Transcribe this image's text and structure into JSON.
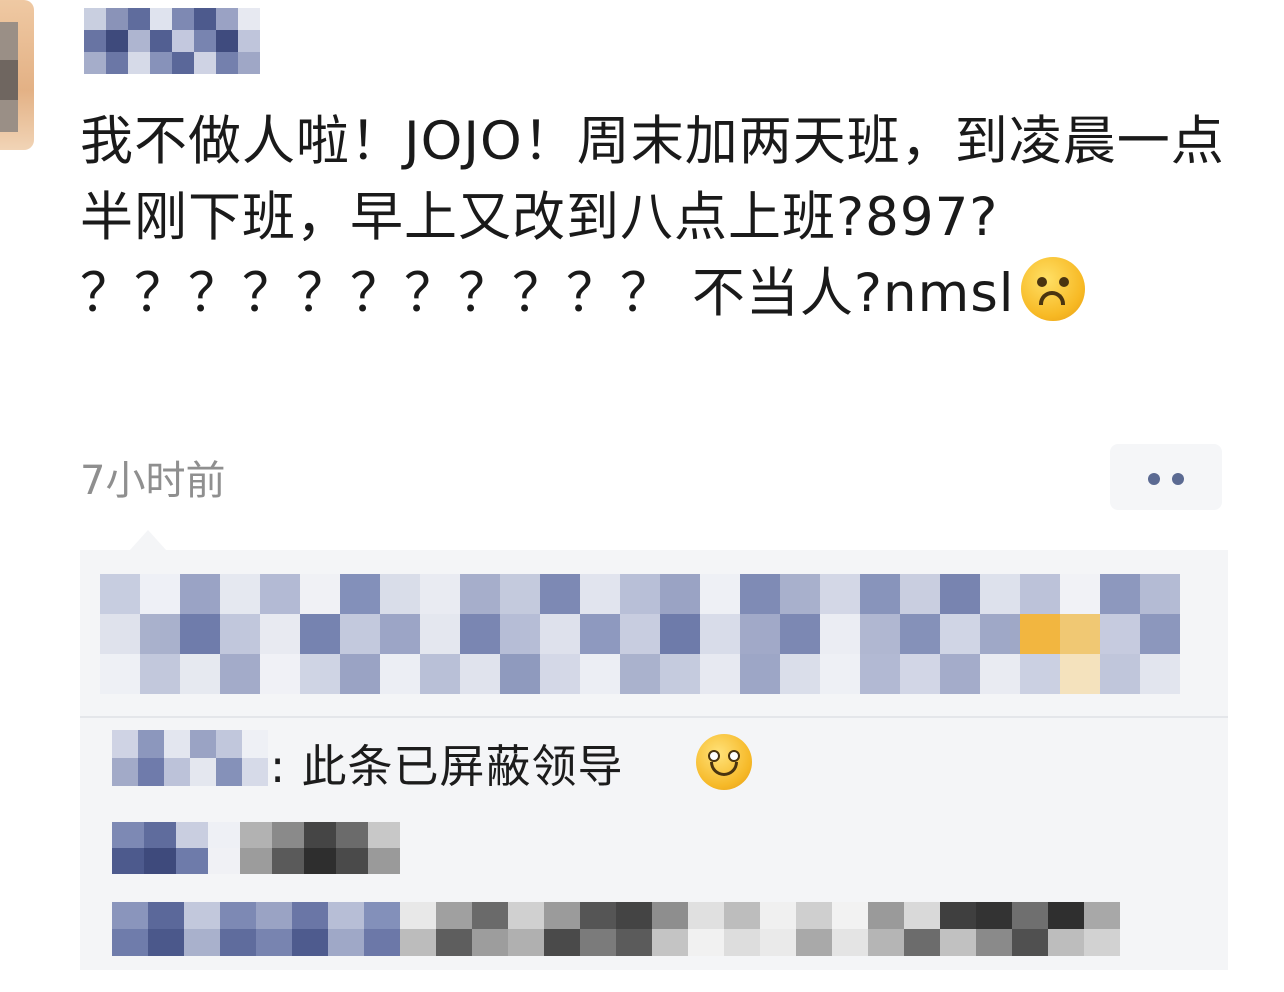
{
  "post": {
    "text": "我不做人啦！JOJO！周末加两天班，到凌晨一点半刚下班，早上又改到八点上班?897? ？？？？？？？？？？？ 不当人?nmsl",
    "emoji_name": "upside-down-face-icon",
    "time": "7小时前",
    "more_icon_name": "more-dots-icon"
  },
  "comments": {
    "visible_text": ": 此条已屏蔽领导",
    "emoji_name": "smiling-face-icon"
  },
  "colors": {
    "accent_link": "#5b6a92",
    "timestamp": "#8f8f8f",
    "panel_bg": "#f4f5f7"
  }
}
